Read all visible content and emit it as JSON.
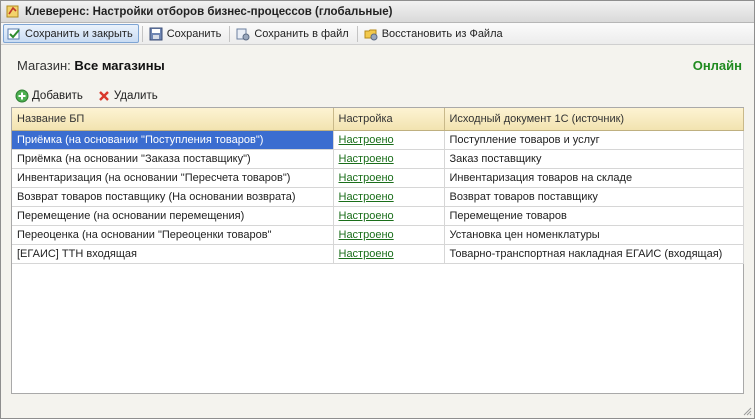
{
  "window": {
    "title": "Клеверенс: Настройки отборов бизнес-процессов (глобальные)"
  },
  "toolbar": {
    "save_close": "Сохранить и закрыть",
    "save": "Сохранить",
    "save_file": "Сохранить в файл",
    "restore_file": "Восстановить из Файла"
  },
  "store": {
    "label": "Магазин: ",
    "value": "Все магазины"
  },
  "status": "Онлайн",
  "actions": {
    "add": "Добавить",
    "delete": "Удалить"
  },
  "table": {
    "columns": [
      "Название БП",
      "Настройка",
      "Исходный документ 1С (источник)"
    ],
    "rows": [
      {
        "name": "Приёмка (на основании \"Поступления товаров\")",
        "setting": "Настроено",
        "source": "Поступление товаров и услуг"
      },
      {
        "name": "Приёмка (на основании \"Заказа поставщику\")",
        "setting": "Настроено",
        "source": "Заказ поставщику"
      },
      {
        "name": "Инвентаризация (на основании \"Пересчета товаров\")",
        "setting": "Настроено",
        "source": "Инвентаризация товаров на складе"
      },
      {
        "name": "Возврат товаров поставщику (На основании возврата)",
        "setting": "Настроено",
        "source": "Возврат товаров поставщику"
      },
      {
        "name": "Перемещение (на основании перемещения)",
        "setting": "Настроено",
        "source": "Перемещение товаров"
      },
      {
        "name": "Переоценка (на основании \"Переоценки товаров\"",
        "setting": "Настроено",
        "source": "Установка цен номенклатуры"
      },
      {
        "name": "[ЕГАИС] ТТН входящая",
        "setting": "Настроено",
        "source": "Товарно-транспортная накладная ЕГАИС (входящая)"
      }
    ]
  },
  "colors": {
    "accent": "#3b6dd0",
    "online": "#1f8a1f",
    "link": "#1a6e1a",
    "header_bg": "#f7ebc4"
  }
}
